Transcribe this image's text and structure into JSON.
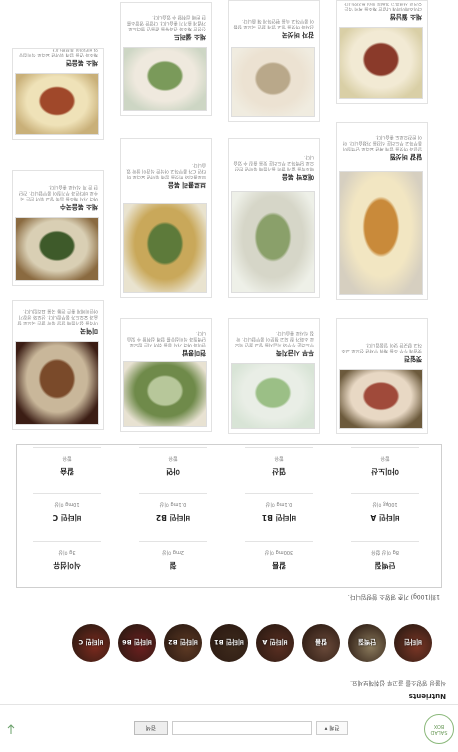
{
  "header": {
    "logo_line1": "SALAD",
    "logo_line2": "BOX",
    "search_select": "전체",
    "search_placeholder": "",
    "search_button": "검색"
  },
  "brand": {
    "title": "Nutrients",
    "description": "식물성 영양소를 골고루 섭취해보세요."
  },
  "categories": [
    {
      "label": "비타민",
      "color": "#7a3626"
    },
    {
      "label": "단백질",
      "color": "#8a7a5c"
    },
    {
      "label": "칼륨",
      "color": "#6a4a3a"
    },
    {
      "label": "비타민 A",
      "color": "#5a2f22"
    },
    {
      "label": "비타민 B1",
      "color": "#3e2a1c"
    },
    {
      "label": "비타민 B2",
      "color": "#5e3a24"
    },
    {
      "label": "비타민 B6",
      "color": "#6b1f1f"
    },
    {
      "label": "비타민 C",
      "color": "#7b2a1e"
    }
  ],
  "note": "1회(100g) 기준 영양소 함량입니다.",
  "nutrients": [
    {
      "name": "단백질",
      "value": "8g 이상 함유"
    },
    {
      "name": "칼륨",
      "value": "300mg 이상"
    },
    {
      "name": "철",
      "value": "2mg 이상"
    },
    {
      "name": "식이섬유",
      "value": "3g 이상"
    },
    {
      "name": "비타민 A",
      "value": "100㎍ 이상"
    },
    {
      "name": "비타민 B1",
      "value": "0.1mg 이상"
    },
    {
      "name": "비타민 B2",
      "value": "0.1mg 이상"
    },
    {
      "name": "비타민 C",
      "value": "10mg 이상"
    },
    {
      "name": "아미노산",
      "value": "함유"
    },
    {
      "name": "엽산",
      "value": "함유"
    },
    {
      "name": "아연",
      "value": "함유"
    },
    {
      "name": "칼슘",
      "value": "함유"
    }
  ],
  "recipes": [
    {
      "title": "미역국",
      "desc": "미역을 참기름에 달달 볶아 끓인 국으로 칼슘과 요오드가 풍부합니다. 산모와 성장기 어린이에게 좋은 전통 국물 요리입니다."
    },
    {
      "title": "현미콩밥",
      "desc": "현미와 여러 가지 콩을 섞어 지은 밥으로 단백질과 식이섬유를 함께 섭취할 수 있습니다."
    },
    {
      "title": "두부 시금치죽",
      "desc": "부드러운 두부와 시금치를 넣고 끓인 죽으로 소화가 잘 되고 철분이 풍부합니다. 아침 식사로 좋습니다."
    },
    {
      "title": "깻잎전",
      "desc": "깻잎에 두부 소를 채워 부쳐낸 전으로 고소하고 향긋한 맛이 일품입니다."
    },
    {
      "title": "채소 볶음국수",
      "desc": "여러 가지 채소를 듬뿍 넣고 볶아 만든 국수로 비타민과 무기질이 풍부합니다. 간단한 한 끼 식사로 좋습니다."
    },
    {
      "title": "브로콜리 볶음",
      "desc": "브로콜리와 버섯을 함께 볶아낸 요리로 비타민 C가 풍부하고 아삭한 식감이 살아 있습니다."
    },
    {
      "title": "애호박 볶음",
      "desc": "애호박을 얇게 썰어 들기름에 볶아낸 반찬으로 담백하고 부드러운 맛을 즐길 수 있습니다."
    },
    {
      "title": "달걀 버섯찜",
      "desc": "달걀과 버섯을 함께 쪄낸 요리로 단백질이 풍부하고 부드러운 식감을 가졌습니다. 아이 반찬으로도 좋습니다."
    },
    {
      "title": "채소 볶음면",
      "desc": "채소와 면을 함께 볶아낸 요리로 식이섬유와 비타민이 풍부합니다."
    },
    {
      "title": "채소 샐러드",
      "desc": "신선한 채소와 견과류를 곁들인 샐러드로 가볍게 즐기기 좋습니다. 다양한 영양소를 한 번에 섭취할 수 있습니다."
    },
    {
      "title": "감자 버섯국",
      "desc": "감자와 버섯을 넣고 맑게 끓인 국으로 칼륨이 풍부하고 속을 편안하게 해 줍니다."
    },
    {
      "title": "채소 월남쌈",
      "desc": "라이스페이퍼에 다양한 채소를 싸서 먹는 요리로 상큼하고 가벼운 맛이 특징입니다."
    }
  ]
}
